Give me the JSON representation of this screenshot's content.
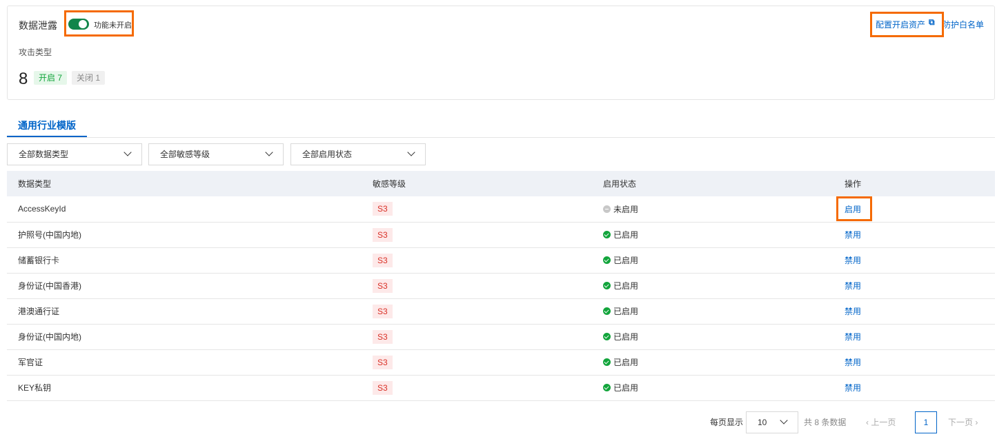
{
  "header": {
    "title": "数据泄露",
    "toggle_label": "功能未开启",
    "toggle_on": true,
    "attack_type_label": "攻击类型",
    "count": "8",
    "enabled_tag": "开启 7",
    "disabled_tag": "关闭 1",
    "config_link": "配置开启资产",
    "whitelist_link": "防护白名单"
  },
  "tab": "通用行业模版",
  "filters": [
    "全部数据类型",
    "全部敏感等级",
    "全部启用状态"
  ],
  "table": {
    "headers": [
      "数据类型",
      "敏感等级",
      "启用状态",
      "操作"
    ],
    "rows": [
      {
        "type": "AccessKeyId",
        "level": "S3",
        "status": "未启用",
        "enabled": false,
        "action": "启用"
      },
      {
        "type": "护照号(中国内地)",
        "level": "S3",
        "status": "已启用",
        "enabled": true,
        "action": "禁用"
      },
      {
        "type": "储蓄银行卡",
        "level": "S3",
        "status": "已启用",
        "enabled": true,
        "action": "禁用"
      },
      {
        "type": "身份证(中国香港)",
        "level": "S3",
        "status": "已启用",
        "enabled": true,
        "action": "禁用"
      },
      {
        "type": "港澳通行证",
        "level": "S3",
        "status": "已启用",
        "enabled": true,
        "action": "禁用"
      },
      {
        "type": "身份证(中国内地)",
        "level": "S3",
        "status": "已启用",
        "enabled": true,
        "action": "禁用"
      },
      {
        "type": "军官证",
        "level": "S3",
        "status": "已启用",
        "enabled": true,
        "action": "禁用"
      },
      {
        "type": "KEY私钥",
        "level": "S3",
        "status": "已启用",
        "enabled": true,
        "action": "禁用"
      }
    ]
  },
  "pagination": {
    "page_size_label": "每页显示",
    "page_size": "10",
    "total": "共 8 条数据",
    "prev": "上一页",
    "current": "1",
    "next": "下一页"
  }
}
